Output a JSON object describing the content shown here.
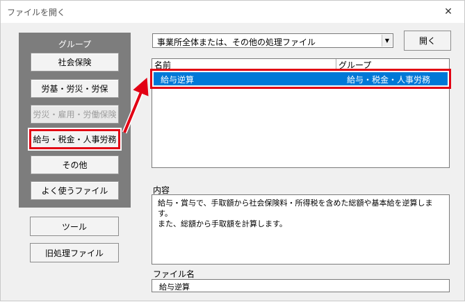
{
  "window": {
    "title": "ファイルを開く",
    "close_glyph": "✕"
  },
  "group_panel": {
    "title": "グループ",
    "items": [
      {
        "label": "社会保険",
        "state": "normal"
      },
      {
        "label": "労基・労災・労保",
        "state": "normal"
      },
      {
        "label": "労災・雇用・労働保険",
        "state": "disabled"
      },
      {
        "label": "給与・税金・人事労務",
        "state": "selected"
      },
      {
        "label": "その他",
        "state": "normal"
      },
      {
        "label": "よく使うファイル",
        "state": "normal"
      }
    ]
  },
  "side_buttons": {
    "tools": "ツール",
    "legacy": "旧処理ファイル"
  },
  "combo": {
    "value": "事業所全体または、その他の処理ファイル",
    "arrow_icon": "▼"
  },
  "open_button": "開く",
  "file_list": {
    "columns": [
      "名前",
      "グループ"
    ],
    "rows": [
      {
        "name": "給与逆算",
        "group": "給与・税金・人事労務",
        "selected": true
      }
    ]
  },
  "description": {
    "label": "内容",
    "lines": [
      "給与・賞与で、手取額から社会保険料・所得税を含めた総額や基本給を逆算します。",
      "また、総額から手取額を計算します。"
    ]
  },
  "filename": {
    "label": "ファイル名",
    "value": "給与逆算"
  },
  "colors": {
    "highlight_red": "#e20014",
    "selection_blue": "#0078d7",
    "panel_gray": "#7d7d7d"
  }
}
